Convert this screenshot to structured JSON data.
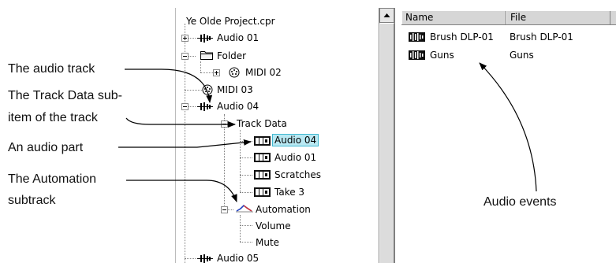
{
  "annotations": {
    "audio_track": "The audio track",
    "track_data_line1": "The Track Data sub-",
    "track_data_line2": "item of the track",
    "audio_part": "An audio part",
    "automation_line1": "The Automation",
    "automation_line2": "subtrack",
    "audio_events": "Audio events"
  },
  "tree": {
    "project": "Ye Olde Project.cpr",
    "items": [
      {
        "label": "Audio 01",
        "icon": "audio-track-icon"
      },
      {
        "label": "Folder",
        "icon": "folder-icon"
      },
      {
        "label": "MIDI 02",
        "icon": "midi-icon"
      },
      {
        "label": "MIDI 03",
        "icon": "midi-icon"
      },
      {
        "label": "Audio 04",
        "icon": "audio-track-icon"
      },
      {
        "label": "Track Data",
        "icon": ""
      },
      {
        "label": "Audio 04",
        "icon": "audio-part-icon"
      },
      {
        "label": "Audio 01",
        "icon": "audio-part-icon"
      },
      {
        "label": "Scratches",
        "icon": "audio-part-icon"
      },
      {
        "label": "Take 3",
        "icon": "audio-part-icon"
      },
      {
        "label": "Automation",
        "icon": "automation-icon"
      },
      {
        "label": "Volume",
        "icon": ""
      },
      {
        "label": "Mute",
        "icon": ""
      },
      {
        "label": "Audio 05",
        "icon": "audio-track-icon"
      }
    ]
  },
  "list": {
    "columns": [
      "Name",
      "File"
    ],
    "rows": [
      {
        "name": "Brush DLP-01",
        "file": "Brush DLP-01"
      },
      {
        "name": "Guns",
        "file": "Guns"
      }
    ]
  },
  "colors": {
    "selection": "#b9e8f2",
    "selection_border": "#3fb8d0",
    "automation": "#2040c0"
  }
}
